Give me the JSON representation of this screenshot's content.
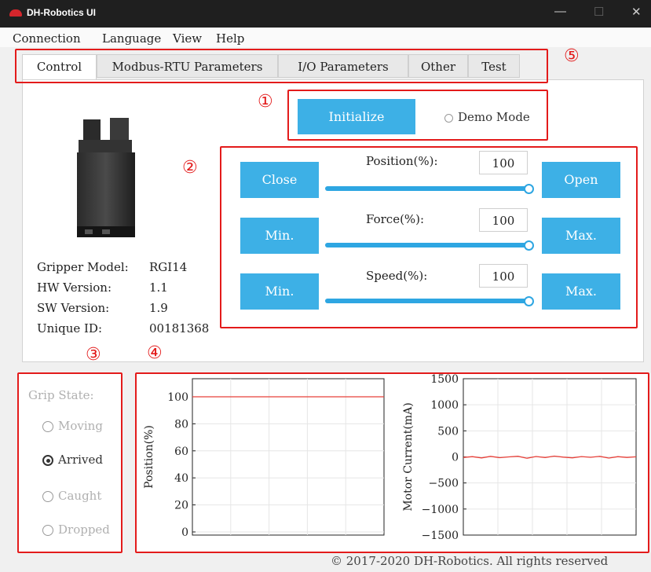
{
  "window": {
    "title": "DH-Robotics UI"
  },
  "menu": [
    "Connection",
    "Language",
    "View",
    "Help"
  ],
  "tabs": [
    "Control",
    "Modbus-RTU Parameters",
    "I/O Parameters",
    "Other",
    "Test"
  ],
  "annotations": {
    "m1": "①",
    "m2": "②",
    "m3": "③",
    "m4": "④",
    "m5": "⑤"
  },
  "init": {
    "button": "Initialize",
    "demo_mode": "Demo Mode",
    "demo_mode_checked": false
  },
  "params": [
    {
      "label": "Position(%):",
      "value": "100",
      "left_button": "Close",
      "right_button": "Open",
      "level": 1.0
    },
    {
      "label": "Force(%):",
      "value": "100",
      "left_button": "Min.",
      "right_button": "Max.",
      "level": 1.0
    },
    {
      "label": "Speed(%):",
      "value": "100",
      "left_button": "Min.",
      "right_button": "Max.",
      "level": 1.0
    }
  ],
  "device": {
    "model_label": "Gripper Model:",
    "model": "RGI14",
    "hw_label": "HW Version:",
    "hw": "1.1",
    "sw_label": "SW Version:",
    "sw": "1.9",
    "uid_label": "Unique ID:",
    "uid": "00181368"
  },
  "grip_state": {
    "title": "Grip State:",
    "options": [
      {
        "label": "Moving",
        "checked": false
      },
      {
        "label": "Arrived",
        "checked": true
      },
      {
        "label": "Caught",
        "checked": false
      },
      {
        "label": "Dropped",
        "checked": false
      }
    ]
  },
  "chart_data": [
    {
      "type": "line",
      "ylabel": "Position(%)",
      "ylim": [
        0,
        110
      ],
      "yticks": [
        "0",
        "20",
        "40",
        "60",
        "80",
        "100"
      ],
      "grid": true,
      "series": [
        {
          "values": [
            100,
            100,
            100,
            100,
            100,
            100,
            100,
            100,
            100,
            100
          ]
        }
      ],
      "line_color": "#e8413a"
    },
    {
      "type": "line",
      "ylabel": "Motor Current(mA)",
      "ylim": [
        -1500,
        1500
      ],
      "yticks": [
        "1500",
        "1000",
        "500",
        "0",
        "−500",
        "−1000",
        "−1500"
      ],
      "grid": true,
      "series": [
        {
          "values": [
            -10,
            5,
            -20,
            10,
            -15,
            0,
            12,
            -25,
            8,
            -12,
            15,
            -5,
            -18,
            6,
            -8,
            10,
            -22,
            4,
            -10,
            2
          ]
        }
      ],
      "line_color": "#e8413a"
    }
  ],
  "footer": "© 2017-2020 DH-Robotics. All rights reserved"
}
